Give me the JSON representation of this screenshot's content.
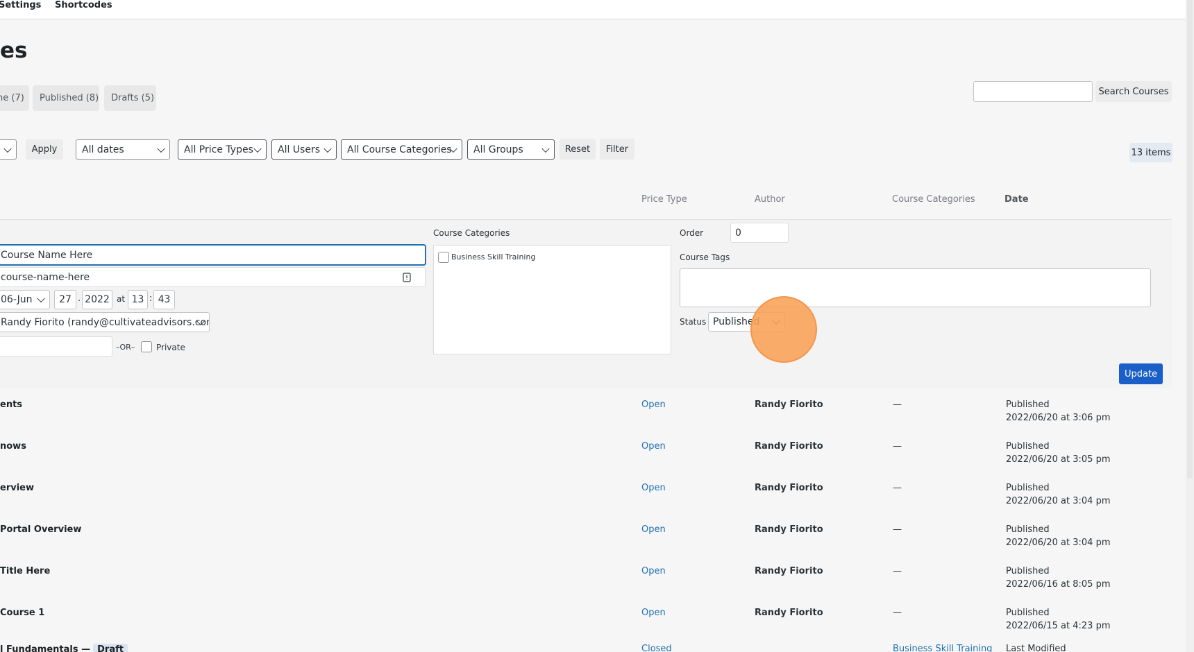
{
  "topbar": {
    "tabs": [
      "Settings",
      "Shortcodes"
    ]
  },
  "page": {
    "title": "es"
  },
  "status_filters": [
    {
      "label": "ne (7)"
    },
    {
      "label": "Published (8)"
    },
    {
      "label": "Drafts (5)"
    }
  ],
  "search": {
    "value": "",
    "button": "Search Courses"
  },
  "filters": {
    "apply": "Apply",
    "dates": "All dates",
    "price_types": "All Price Types",
    "users": "All Users",
    "course_categories": "All Course Categories",
    "groups": "All Groups",
    "reset": "Reset",
    "filter": "Filter",
    "items_count": "13 items"
  },
  "columns": {
    "price_type": "Price Type",
    "author": "Author",
    "course_categories": "Course Categories",
    "date": "Date"
  },
  "quick_edit": {
    "title_value": "Course Name Here",
    "slug_value": "course-name-here",
    "date_month": "06-Jun",
    "date_day": "27",
    "date_year": "2022",
    "at_label": "at",
    "date_dot": ".",
    "time_sep": ":",
    "hour": "13",
    "minute": "43",
    "author_value": "Randy Fiorito (randy@cultivateadvisors.com)",
    "password_value": "",
    "or_label": "–OR–",
    "private_label": "Private",
    "categories_label": "Course Categories",
    "categories": [
      {
        "label": "Business Skill Training",
        "checked": false
      }
    ],
    "order_label": "Order",
    "order_value": "0",
    "tags_label": "Course Tags",
    "tags_value": "",
    "status_label": "Status",
    "status_value": "Published",
    "update_button": "Update"
  },
  "rows": [
    {
      "name": "ents",
      "price": "Open",
      "author": "Randy Fiorito",
      "cats": "—",
      "status": "Published",
      "date": "2022/06/20 at 3:06 pm"
    },
    {
      "name": "nows",
      "price": "Open",
      "author": "Randy Fiorito",
      "cats": "—",
      "status": "Published",
      "date": "2022/06/20 at 3:05 pm"
    },
    {
      "name": "erview",
      "price": "Open",
      "author": "Randy Fiorito",
      "cats": "—",
      "status": "Published",
      "date": "2022/06/20 at 3:04 pm"
    },
    {
      "name": "Portal Overview",
      "price": "Open",
      "author": "Randy Fiorito",
      "cats": "—",
      "status": "Published",
      "date": "2022/06/20 at 3:04 pm"
    },
    {
      "name": "Title Here",
      "price": "Open",
      "author": "Randy Fiorito",
      "cats": "—",
      "status": "Published",
      "date": "2022/06/16 at 8:05 pm"
    },
    {
      "name": "Course 1",
      "price": "Open",
      "author": "Randy Fiorito",
      "cats": "—",
      "status": "Published",
      "date": "2022/06/15 at 4:23 pm"
    },
    {
      "name": "l Fundamentals —",
      "badge": "Draft",
      "price": "Closed",
      "author": "",
      "cats": "Business Skill Training",
      "status": "Last Modified",
      "date": ""
    }
  ]
}
